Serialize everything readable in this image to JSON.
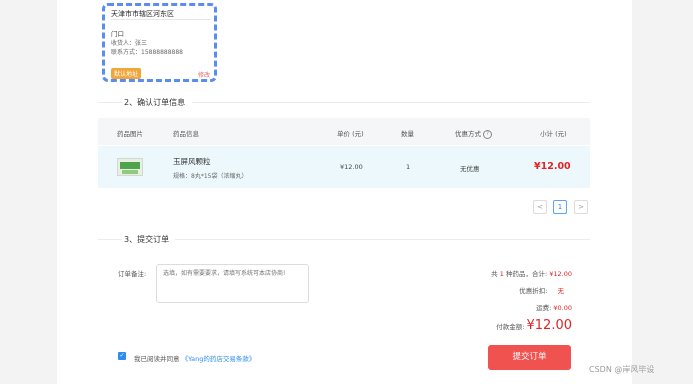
{
  "address": {
    "region": "天津市市辖区河东区",
    "detail": "门口",
    "receiver": "收货人：张三",
    "phone": "联系方式：15888888888",
    "default_badge": "默认地址",
    "edit_label": "修改"
  },
  "section2": {
    "title": "2、确认订单信息"
  },
  "table": {
    "headers": [
      "药品图片",
      "药品信息",
      "单价 (元)",
      "数量",
      "优惠方式",
      "小计 (元)"
    ],
    "row": {
      "name": "玉屏风颗粒",
      "spec": "规格：8丸*15袋（浓缩丸）",
      "price": "¥12.00",
      "qty": "1",
      "discount": "无优惠",
      "subtotal": "¥12.00"
    }
  },
  "pagination": {
    "prev": "<",
    "current": "1",
    "next": ">"
  },
  "section3": {
    "title": "3、提交订单"
  },
  "remark": {
    "label": "订单备注:",
    "placeholder": "选填，如有需要要求，请填写系统可本店协商!"
  },
  "summary": {
    "count_prefix": "共",
    "count": "1",
    "count_suffix": "种药品，合计:",
    "total": "¥12.00",
    "discount_label": "优惠折扣:",
    "discount_value": "无",
    "shipping_label": "运费:",
    "shipping_value": "¥0.00",
    "pay_label": "付款金额:",
    "pay_value": "¥12.00"
  },
  "agreement": {
    "text": "我已阅读并同意",
    "link": "《Yang的药店交易条款》"
  },
  "submit_label": "提交订单",
  "watermark": "CSDN @岸风毕设",
  "colors": {
    "accent_blue": "#2d8cf0",
    "price_red": "#e02424",
    "submit_red": "#f0524f",
    "badge_orange": "#f0a63a"
  }
}
